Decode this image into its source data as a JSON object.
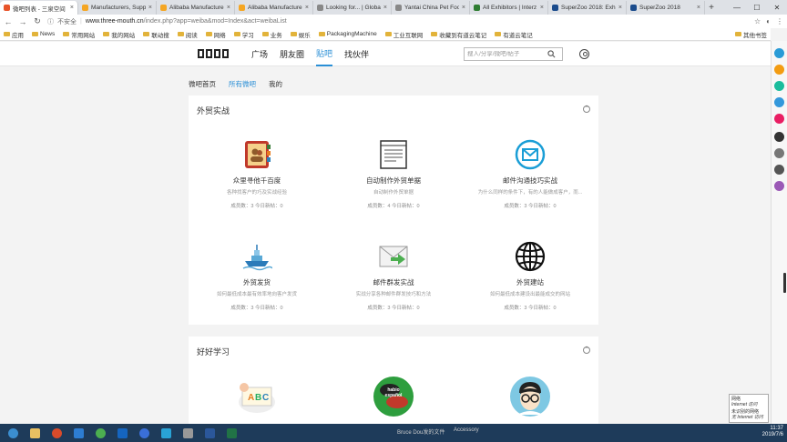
{
  "browser": {
    "tabs": [
      {
        "label": "微吧列表 - 三泉空间",
        "active": true,
        "color": "#e8542a"
      },
      {
        "label": "Manufacturers, Suppli",
        "active": false,
        "color": "#f5a623"
      },
      {
        "label": "Alibaba Manufacture",
        "active": false,
        "color": "#f5a623"
      },
      {
        "label": "Alibaba Manufacture",
        "active": false,
        "color": "#f5a623"
      },
      {
        "label": "Looking for... | Global",
        "active": false,
        "color": "#888888"
      },
      {
        "label": "Yantai China Pet Foo",
        "active": false,
        "color": "#888888"
      },
      {
        "label": "All Exhibitors | Interz",
        "active": false,
        "color": "#2f7d32"
      },
      {
        "label": "SuperZoo 2018: Exhib",
        "active": false,
        "color": "#1a4b8c"
      },
      {
        "label": "SuperZoo 2018",
        "active": false,
        "color": "#1a4b8c"
      }
    ],
    "insecure_label": "不安全",
    "url_host": "www.three-mouth.cn",
    "url_path": "/index.php?app=weiba&mod=Index&act=weibaList",
    "bookmarks": [
      "应用",
      "News",
      "常用网站",
      "我的网站",
      "联动搜",
      "阅读",
      "网络",
      "学习",
      "业务",
      "娱乐",
      "PackagingMachine",
      "工业互联网",
      "收藏到有道云笔记",
      "有道云笔记"
    ],
    "other_bookmarks": "其他书签"
  },
  "site": {
    "nav": [
      {
        "label": "广场",
        "active": false
      },
      {
        "label": "朋友圈",
        "active": false
      },
      {
        "label": "贴吧",
        "active": true
      },
      {
        "label": "找伙伴",
        "active": false
      }
    ],
    "search_placeholder": "搜人/分享/微吧/帖子",
    "subtabs": [
      {
        "label": "微吧首页",
        "active": false
      },
      {
        "label": "所有微吧",
        "active": true
      },
      {
        "label": "我的",
        "active": false
      }
    ],
    "sections": [
      {
        "title": "外贸实战",
        "collapse_glyph": "^",
        "items": [
          {
            "name": "众里寻他千百度",
            "desc": "各种找客户的巧及实战经验",
            "stats": "成员数：3  今日新帖：0",
            "icon": "address-book-icon"
          },
          {
            "name": "自动制作外贸单据",
            "desc": "自动制作外贸单据",
            "stats": "成员数：4  今日新帖：0",
            "icon": "document-stack-icon"
          },
          {
            "name": "邮件沟通技巧实战",
            "desc": "为什么同样的条件下，有的人能做成客户，而...",
            "stats": "成员数：3  今日新帖：0",
            "icon": "mail-circle-icon"
          },
          {
            "name": "外贸发货",
            "desc": "如何最低成本最有效率地向客户发货",
            "stats": "成员数：3  今日新帖：0",
            "icon": "ship-icon"
          },
          {
            "name": "邮件群发实战",
            "desc": "实战分享各种邮件群发技巧和方法",
            "stats": "成员数：3  今日新帖：0",
            "icon": "envelope-arrow-icon"
          },
          {
            "name": "外贸建站",
            "desc": "如何最低成本建设出最能成交的网站",
            "stats": "成员数：3  今日新帖：0",
            "icon": "globe-icon"
          }
        ]
      },
      {
        "title": "好好学习",
        "collapse_glyph": "^",
        "items": [
          {
            "name": "",
            "desc": "",
            "stats": "",
            "icon": "abc-book-icon",
            "badge": ""
          },
          {
            "name": "",
            "desc": "",
            "stats": "",
            "icon": "speech-bubble-icon",
            "badge": "habio español"
          },
          {
            "name": "",
            "desc": "",
            "stats": "",
            "icon": "avatar-glasses-icon",
            "badge": ""
          }
        ]
      }
    ]
  },
  "popup": {
    "line1": "网络",
    "line2": "Internet 访问",
    "line3": "未识别的网络",
    "line4": "无 Internet 访问"
  },
  "taskbar": {
    "notice": "Bruce Dou发的文件",
    "accessory": "Accessory",
    "time": "11:37",
    "date": "2019/7/6"
  },
  "colors": {
    "accent": "#2a8fd6",
    "taskbar": "#1e3b5a"
  }
}
